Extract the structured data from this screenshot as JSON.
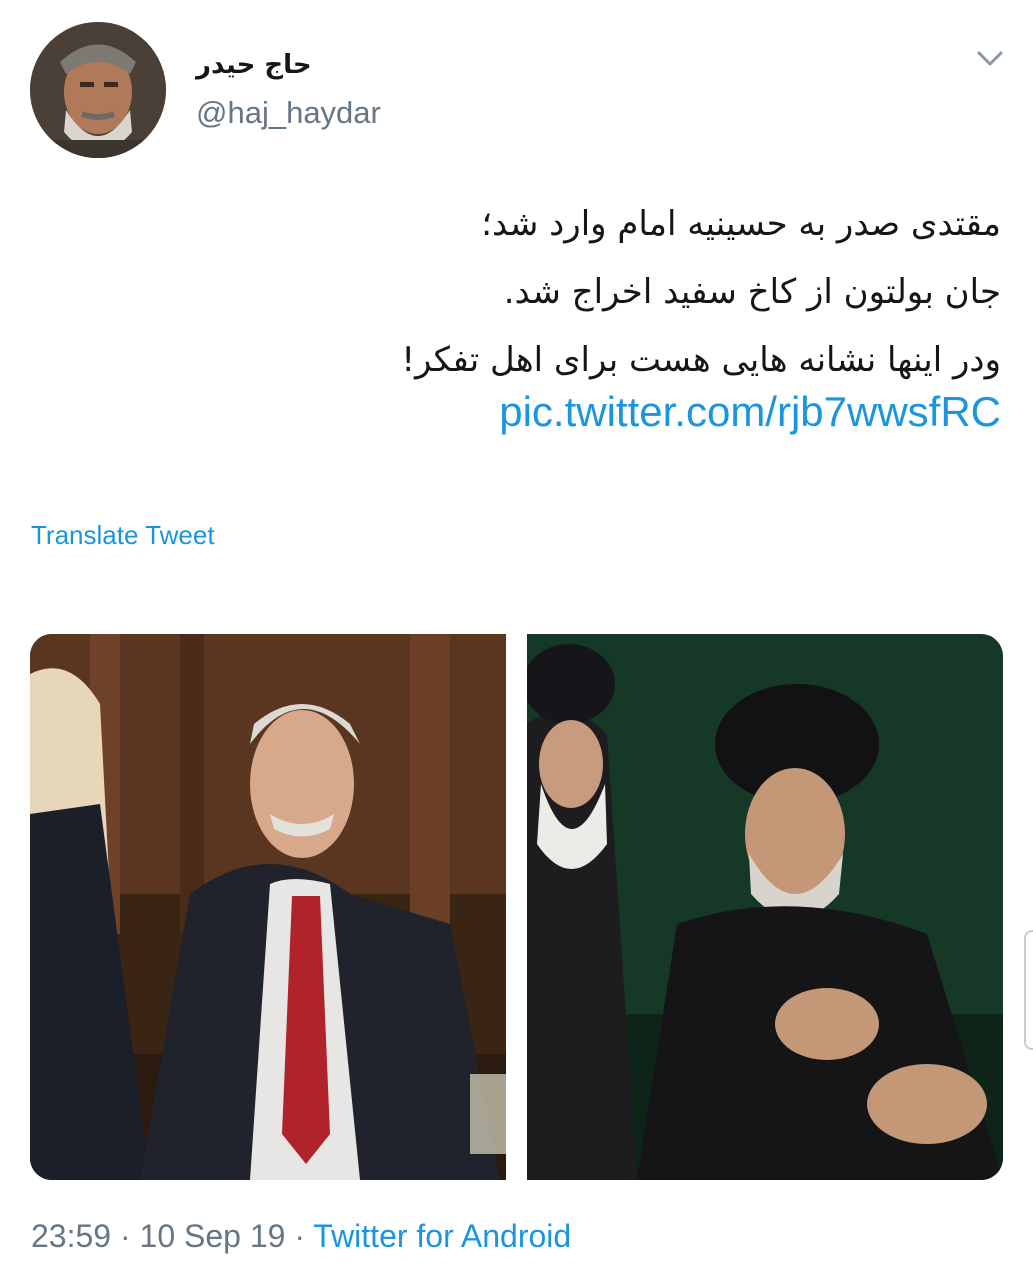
{
  "user": {
    "display_name": "حاج حیدر",
    "handle": "@haj_haydar"
  },
  "tweet": {
    "lines": [
      "مقتدی صدر به حسینیه امام وارد شد؛",
      "جان بولتون از کاخ سفید اخراج شد.",
      "ودر اینها نشانه هایی هست برای اهل تفکر!"
    ],
    "link": "pic.twitter.com/rjb7wwsfRC",
    "translate_label": "Translate Tweet"
  },
  "meta": {
    "time": "23:59",
    "date": "10 Sep 19",
    "separator": "·",
    "source": "Twitter for Android"
  },
  "icons": {
    "caret": "chevron-down-icon"
  },
  "colors": {
    "link": "#1b95e0",
    "secondary_text": "#657786",
    "primary_text": "#14171a"
  }
}
